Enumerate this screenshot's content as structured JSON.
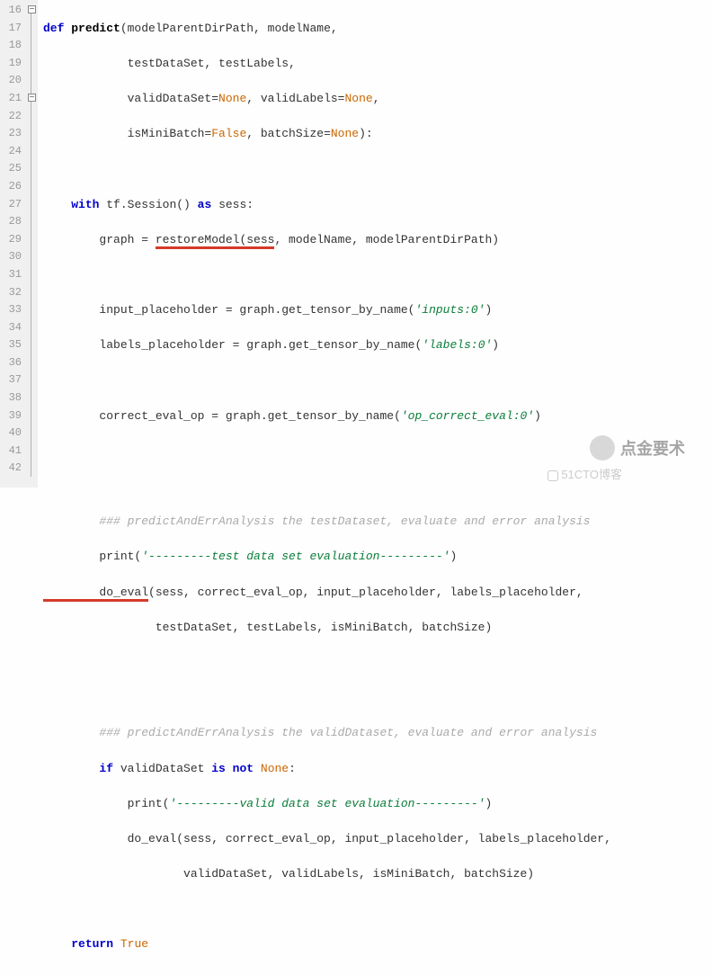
{
  "gutter": {
    "start": 16,
    "end": 42
  },
  "fold_markers": {
    "line16": true,
    "line21": true
  },
  "code": {
    "l16_def": "def",
    "l16_fn": "predict",
    "l16_rest": "(modelParentDirPath, modelName,",
    "l17": "            testDataSet, testLabels,",
    "l18_a": "            validDataSet=",
    "l18_none1": "None",
    "l18_b": ", validLabels=",
    "l18_none2": "None",
    "l18_c": ",",
    "l19_a": "            isMiniBatch=",
    "l19_false": "False",
    "l19_b": ", batchSize=",
    "l19_none": "None",
    "l19_c": "):",
    "l21_with": "with",
    "l21_a": " tf.Session() ",
    "l21_as": "as",
    "l21_b": " sess:",
    "l22_a": "        graph = ",
    "l22_u": "restoreModel(sess",
    "l22_b": ", modelName, modelParentDirPath)",
    "l24_a": "        input_placeholder = graph.get_tensor_by_name(",
    "l24_s": "'inputs:0'",
    "l24_b": ")",
    "l25_a": "        labels_placeholder = graph.get_tensor_by_name(",
    "l25_s": "'labels:0'",
    "l25_b": ")",
    "l27_a": "        correct_eval_op = graph.get_tensor_by_name(",
    "l27_s": "'op_correct_eval:0'",
    "l27_b": ")",
    "l30_c": "        ### predictAndErrAnalysis the testDataset, evaluate and error analysis",
    "l31_a": "        print(",
    "l31_s": "'---------test data set evaluation---------'",
    "l31_b": ")",
    "l32_u": "        do_eval",
    "l32_b": "(sess, correct_eval_op, input_placeholder, labels_placeholder,",
    "l33": "                testDataSet, testLabels, isMiniBatch, batchSize)",
    "l36_c": "        ### predictAndErrAnalysis the validDataset, evaluate and error analysis",
    "l37_if": "if",
    "l37_a": " validDataSet ",
    "l37_is": "is",
    "l37_not": "not",
    "l37_none": "None",
    "l37_b": ":",
    "l38_a": "            print(",
    "l38_s": "'---------valid data set evaluation---------'",
    "l38_b": ")",
    "l39": "            do_eval(sess, correct_eval_op, input_placeholder, labels_placeholder,",
    "l40": "                    validDataSet, validLabels, isMiniBatch, batchSize)",
    "l42_a": "    ",
    "l42_ret": "return",
    "l42_b": " ",
    "l42_true": "True"
  },
  "watermark": {
    "name": "点金要术",
    "source": "51CTO博客"
  }
}
